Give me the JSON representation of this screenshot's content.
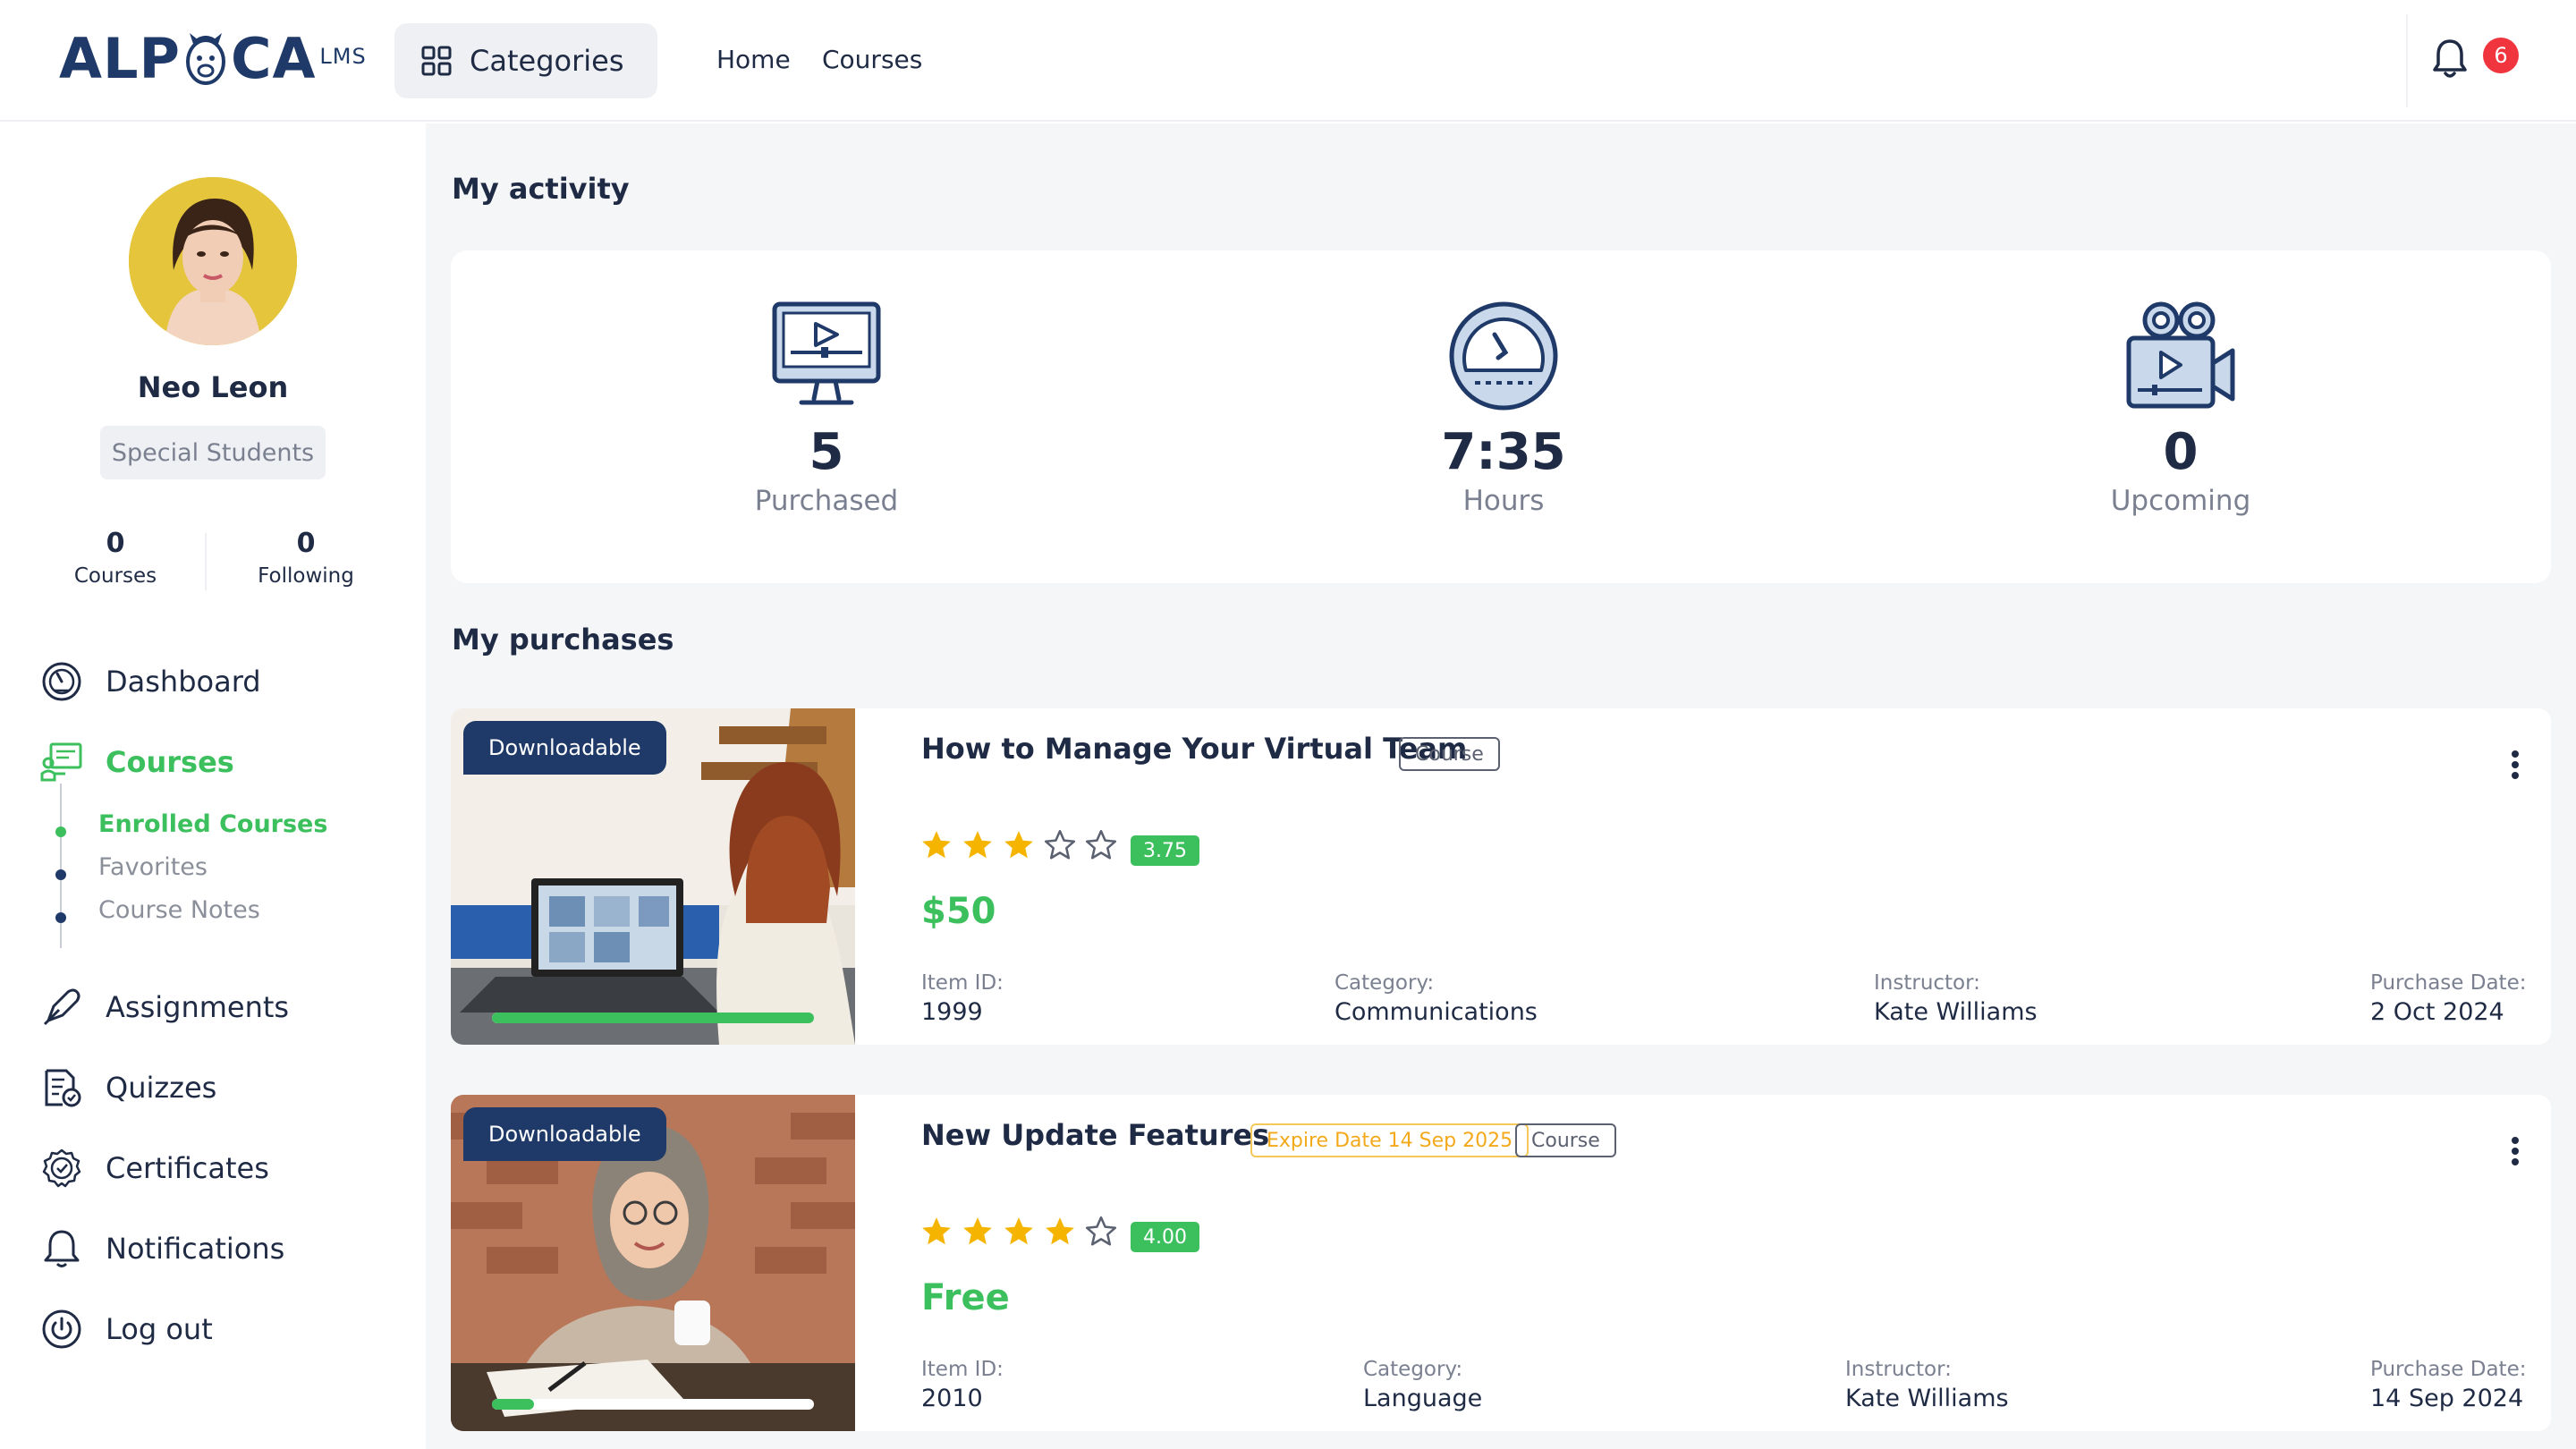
{
  "header": {
    "logo_text_left": "ALP",
    "logo_text_right": "CA",
    "logo_suffix": "LMS",
    "categories_label": "Categories",
    "nav": [
      "Home",
      "Courses"
    ],
    "notification_count": "6"
  },
  "profile": {
    "name": "Neo Leon",
    "role": "Special Students",
    "stats": [
      {
        "value": "0",
        "label": "Courses"
      },
      {
        "value": "0",
        "label": "Following"
      }
    ]
  },
  "menu": {
    "dashboard": "Dashboard",
    "courses": "Courses",
    "sub": [
      "Enrolled Courses",
      "Favorites",
      "Course Notes"
    ],
    "assignments": "Assignments",
    "quizzes": "Quizzes",
    "certificates": "Certificates",
    "notifications": "Notifications",
    "logout": "Log out"
  },
  "activity": {
    "title": "My activity",
    "items": [
      {
        "value": "5",
        "label": "Purchased",
        "icon": "monitor-play-icon"
      },
      {
        "value": "7:35",
        "label": "Hours",
        "icon": "gauge-icon"
      },
      {
        "value": "0",
        "label": "Upcoming",
        "icon": "video-camera-icon"
      }
    ]
  },
  "purchases": {
    "title": "My purchases",
    "items": [
      {
        "badge": "Downloadable",
        "title": "How to Manage Your Virtual Team",
        "expire": "",
        "type": "Course",
        "rating": "3.75",
        "stars_filled": 3,
        "price": "$50",
        "progress": 1.0,
        "meta": [
          {
            "k": "Item ID:",
            "v": "1999"
          },
          {
            "k": "Category:",
            "v": "Communications"
          },
          {
            "k": "Instructor:",
            "v": "Kate Williams"
          },
          {
            "k": "Purchase Date:",
            "v": "2 Oct 2024"
          }
        ]
      },
      {
        "badge": "Downloadable",
        "title": "New Update Features",
        "expire": "Expire Date 14 Sep 2025",
        "type": "Course",
        "rating": "4.00",
        "stars_filled": 4,
        "price": "Free",
        "progress": 0.13,
        "meta": [
          {
            "k": "Item ID:",
            "v": "2010"
          },
          {
            "k": "Category:",
            "v": "Language"
          },
          {
            "k": "Instructor:",
            "v": "Kate Williams"
          },
          {
            "k": "Purchase Date:",
            "v": "14 Sep 2024"
          }
        ]
      }
    ]
  },
  "colors": {
    "brand": "#1f3a68",
    "accent": "#3cc05d",
    "badge_red": "#f0353e",
    "warn": "#f3a91a"
  }
}
